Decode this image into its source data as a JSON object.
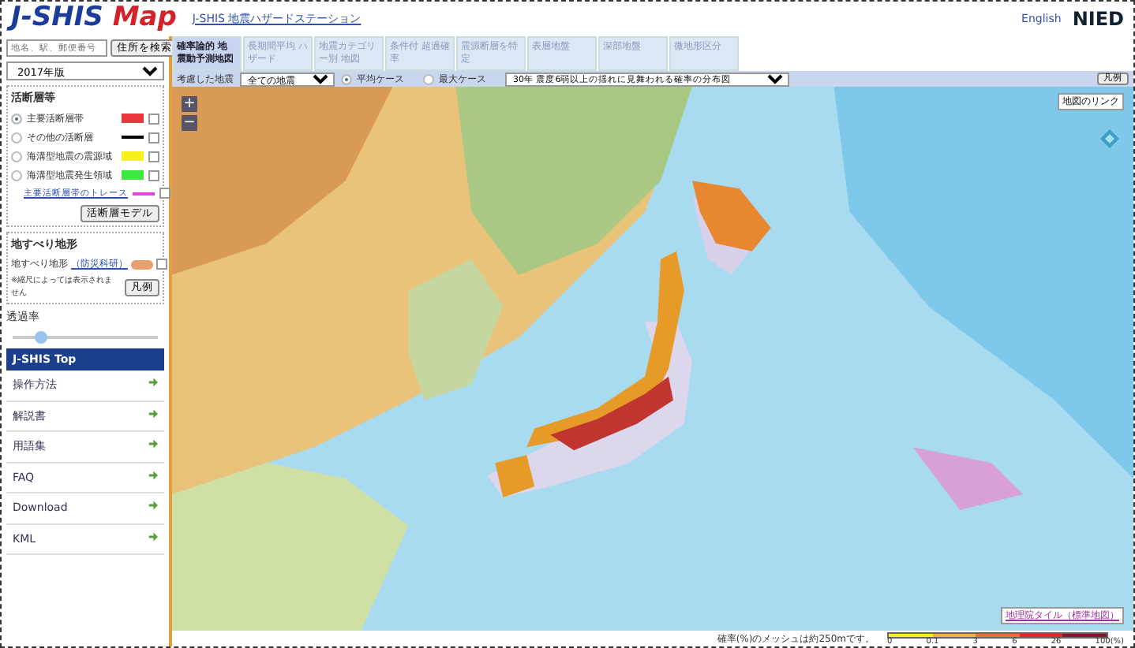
{
  "header": {
    "logo": "J-SHIS Map",
    "link": "J-SHIS 地震ハザードステーション",
    "language": "English",
    "org": "NIED"
  },
  "search": {
    "placeholder": "地名、駅、郵便番号",
    "button": "住所を検索"
  },
  "version": {
    "value": "2017年版"
  },
  "faults": {
    "title": "活断層等",
    "items": [
      {
        "kind": "radio",
        "label": "主要活断層帯",
        "selected": true,
        "color": "#e8383d",
        "checked": false
      },
      {
        "kind": "radio",
        "label": "その他の活断層",
        "selected": false,
        "color": "#000000",
        "checked": false
      },
      {
        "kind": "radio",
        "label": "海溝型地震の震源域",
        "selected": false,
        "color": "#f5f01e",
        "checked": false
      },
      {
        "kind": "radio",
        "label": "海溝型地震発生領域",
        "selected": false,
        "color": "#3ee83e",
        "checked": false
      },
      {
        "kind": "link",
        "label": "主要活断層帯のトレース",
        "color": "#e83ee8",
        "checked": false
      }
    ],
    "button": "活断層モデル"
  },
  "landslide": {
    "title": "地すべり地形",
    "label": "地すべり地形",
    "source": "（防災科研）",
    "color": "#e8a070",
    "checked": false,
    "note": "※縮尺によっては表示されません",
    "button": "凡例"
  },
  "opacity": {
    "label": "透過率",
    "level": 0.2
  },
  "menu": {
    "title": "J-SHIS Top",
    "items": [
      {
        "label": "操作方法"
      },
      {
        "label": "解説書"
      },
      {
        "label": "用語集"
      },
      {
        "label": "FAQ"
      },
      {
        "label": "Download"
      },
      {
        "label": "KML"
      }
    ]
  },
  "tabs": [
    {
      "label": "確率論的 地震動予測地図",
      "selected": true
    },
    {
      "label": "長期間平均 ハザード",
      "selected": false
    },
    {
      "label": "地震カテゴリー別 地図",
      "selected": false
    },
    {
      "label": "条件付 超過確率",
      "selected": false
    },
    {
      "label": "震源断層を特定",
      "selected": false
    },
    {
      "label": "表層地盤",
      "selected": false
    },
    {
      "label": "深部地盤",
      "selected": false
    },
    {
      "label": "微地形区分",
      "selected": false
    }
  ],
  "toolbar": {
    "quake_label": "考慮した地震",
    "quake_value": "全ての地震",
    "cases": [
      {
        "label": "平均ケース",
        "selected": true
      },
      {
        "label": "最大ケース",
        "selected": false
      }
    ],
    "map_value": "30年 震度6弱以上の揺れに見舞われる確率の分布図",
    "legend_button": "凡例"
  },
  "map": {
    "zoom_in": "+",
    "zoom_out": "−",
    "link_button": "地図のリンク",
    "attribution": "地理院タイル（標準地図）"
  },
  "legend": {
    "note": "確率(%)のメッシュは約250mです。",
    "ticks": [
      "0",
      "0.1",
      "3",
      "6",
      "26",
      "100(%)"
    ],
    "segments": [
      {
        "color": "#f5f01e"
      },
      {
        "color": "#f5b040"
      },
      {
        "color": "#f07030"
      },
      {
        "color": "#e02828"
      },
      {
        "color": "#901030"
      }
    ]
  }
}
